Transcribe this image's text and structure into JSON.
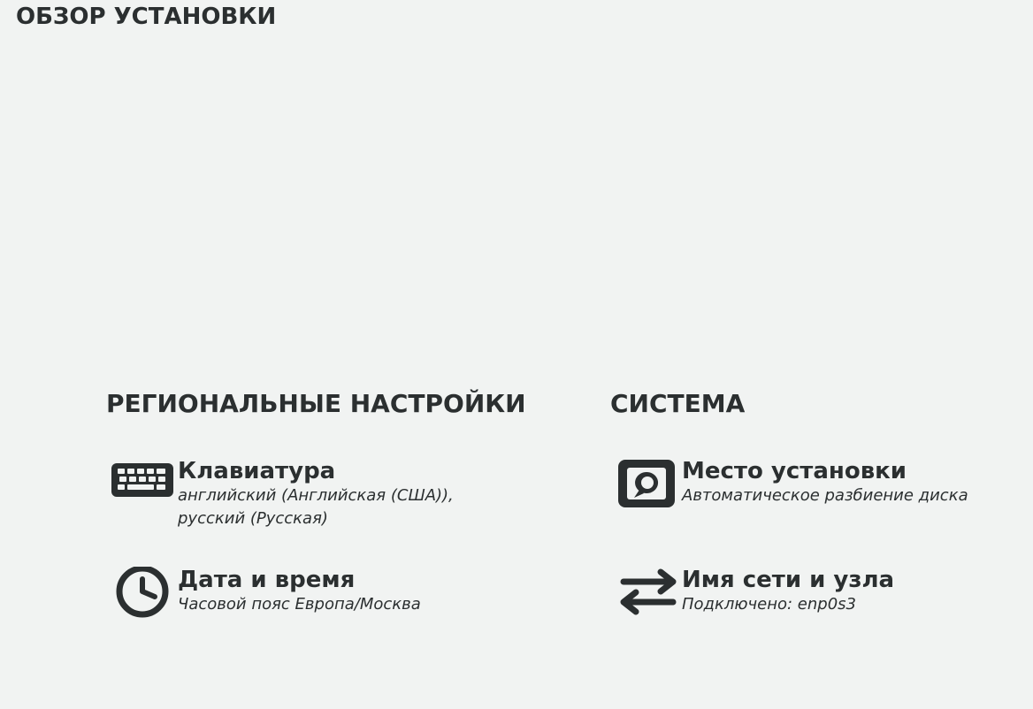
{
  "header": {
    "title": "ОБЗОР УСТАНОВКИ"
  },
  "categories": {
    "regional": {
      "title": "РЕГИОНАЛЬНЫЕ НАСТРОЙКИ",
      "spokes": {
        "keyboard": {
          "icon": "keyboard-icon",
          "title": "Клавиатура",
          "status": "английский (Английская (США)), русский (Русская)"
        },
        "datetime": {
          "icon": "clock-icon",
          "title": "Дата и время",
          "status": "Часовой пояс Европа/Москва"
        }
      }
    },
    "system": {
      "title": "СИСТЕМА",
      "spokes": {
        "storage": {
          "icon": "hard-disk-icon",
          "title": "Место установки",
          "status": "Автоматическое разбиение диска"
        },
        "network": {
          "icon": "network-arrows-icon",
          "title": "Имя сети и узла",
          "status": "Подключено: enp0s3"
        }
      }
    }
  },
  "colors": {
    "background": "#f1f3f2",
    "text": "#2b2f30"
  }
}
